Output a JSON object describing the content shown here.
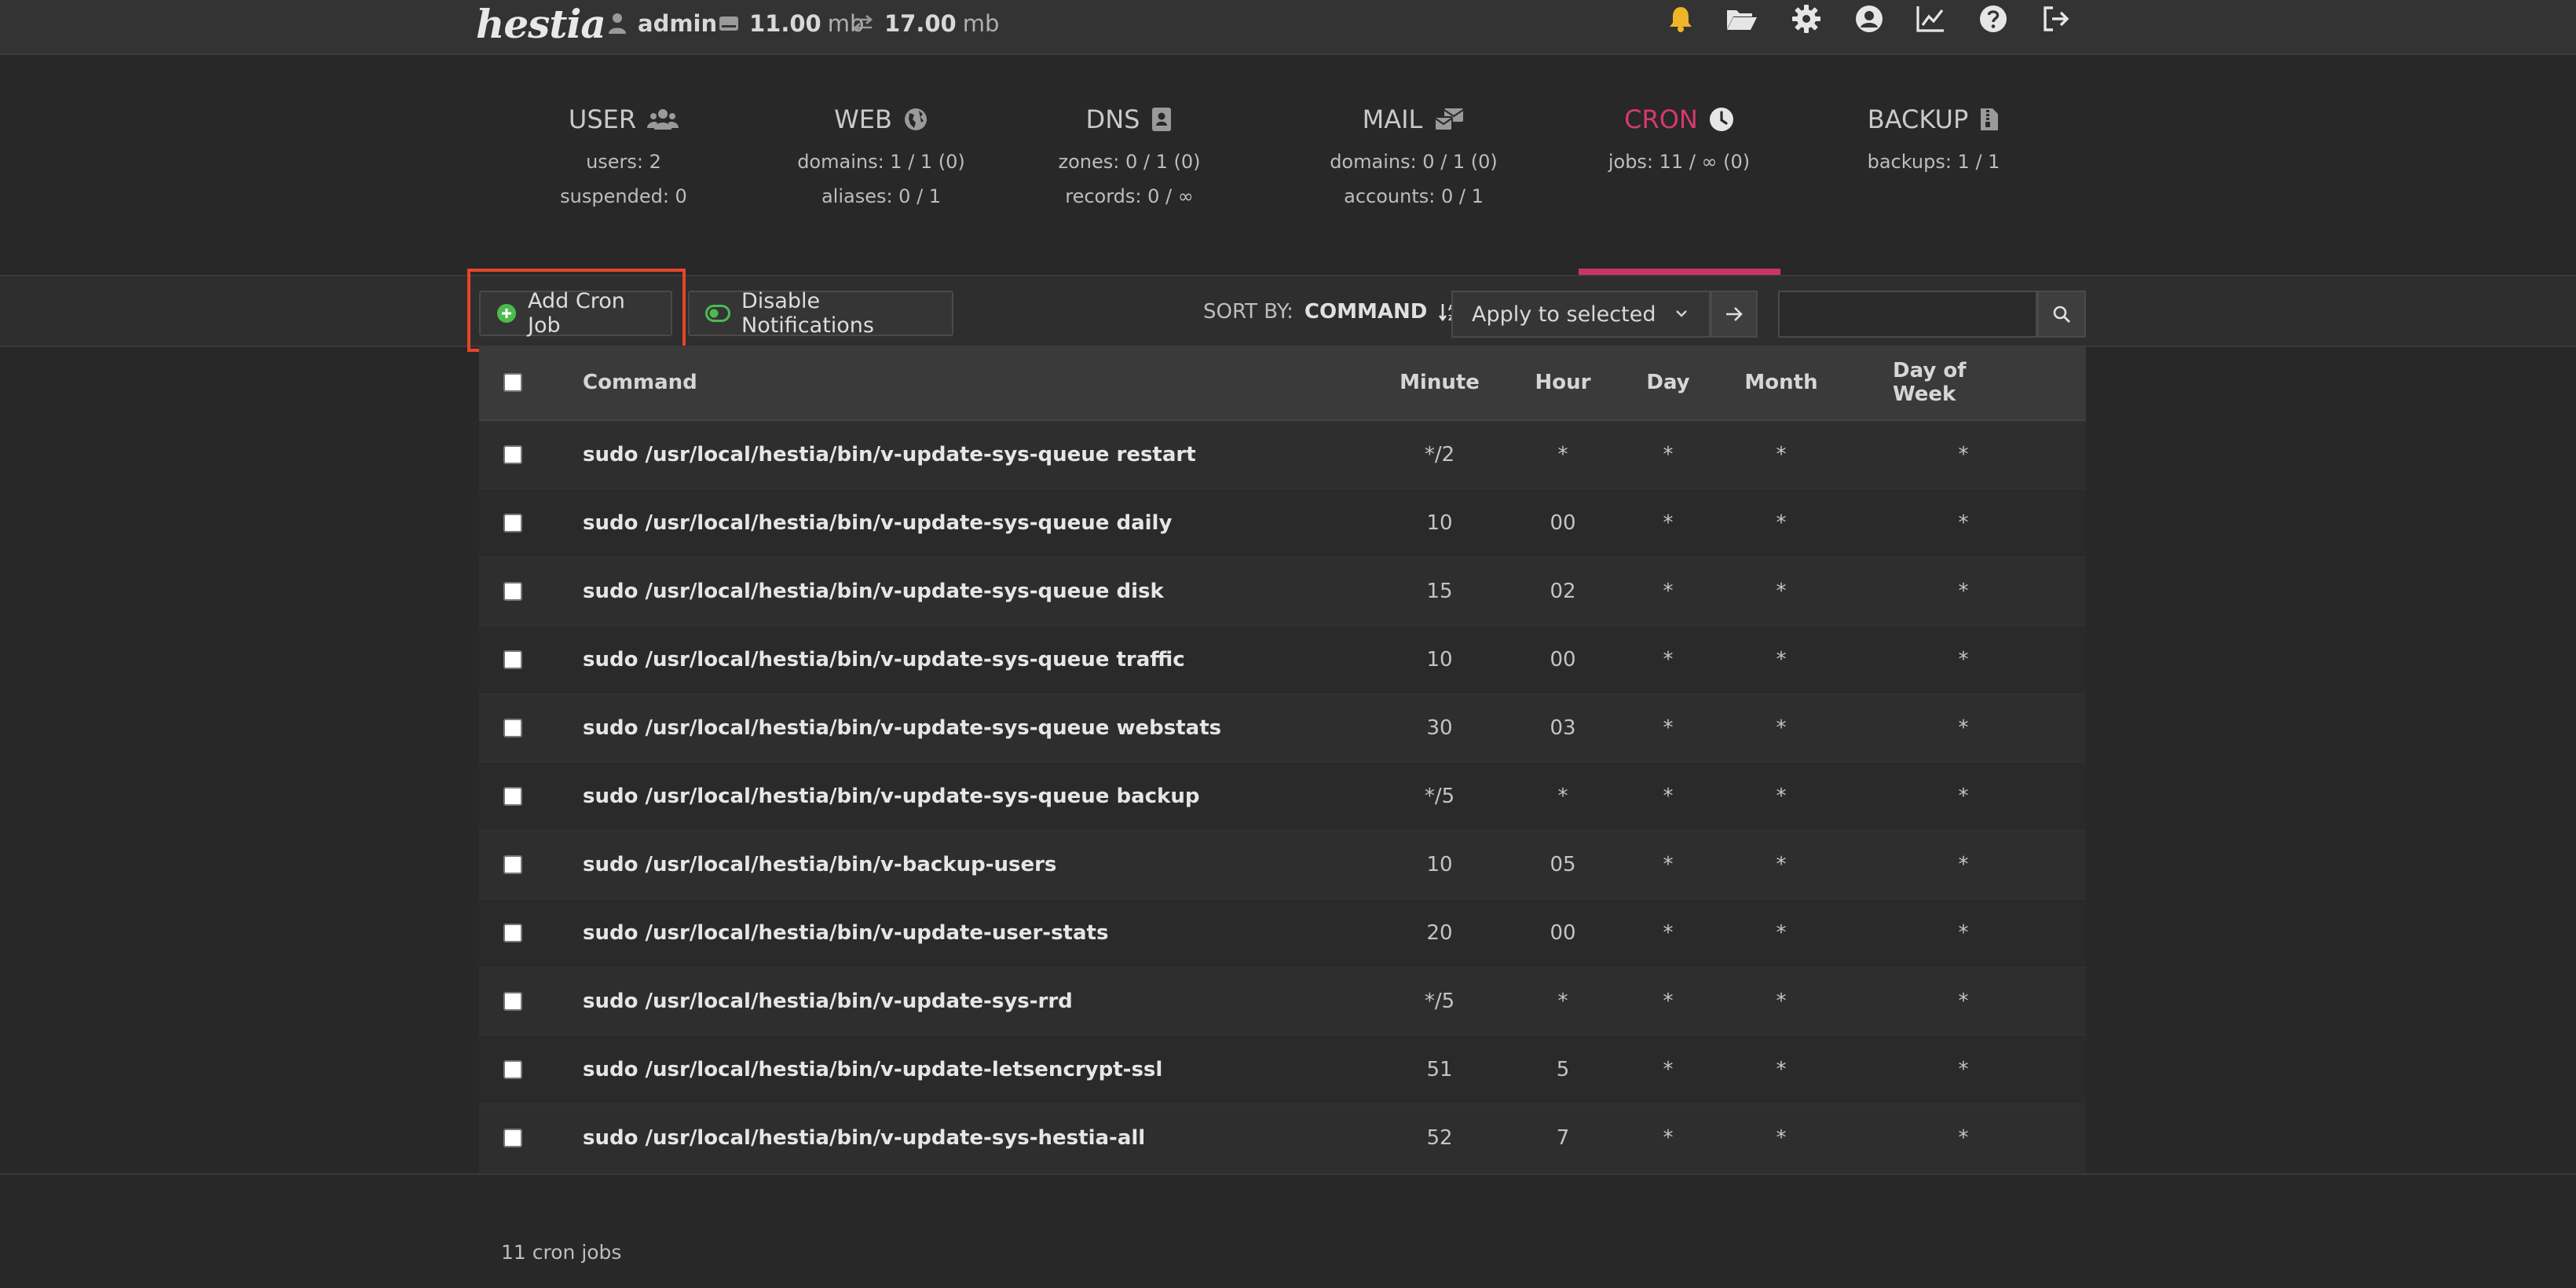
{
  "topbar": {
    "logo": "hestia",
    "user": "admin",
    "disk": "11.00",
    "disk_unit": "mb",
    "bandwidth": "17.00",
    "bandwidth_unit": "mb",
    "icons": [
      "bell-icon",
      "folder-open-icon",
      "gear-icon",
      "user-circle-icon",
      "chart-line-icon",
      "help-icon",
      "logout-icon"
    ],
    "bell_color": "#f0b429"
  },
  "stats": {
    "user": {
      "title": "USER",
      "line1": "users: 2",
      "line2": "suspended: 0"
    },
    "web": {
      "title": "WEB",
      "line1": "domains: 1 / 1 (0)",
      "line2": "aliases: 0 / 1"
    },
    "dns": {
      "title": "DNS",
      "line1": "zones: 0 / 1 (0)",
      "line2": "records: 0 / ∞"
    },
    "mail": {
      "title": "MAIL",
      "line1": "domains: 0 / 1 (0)",
      "line2": "accounts: 0 / 1"
    },
    "cron": {
      "title": "CRON",
      "line1": "jobs: 11 / ∞ (0)"
    },
    "backup": {
      "title": "BACKUP",
      "line1": "backups: 1 / 1"
    },
    "active_color": "#d6396f"
  },
  "toolbar": {
    "add_label": "Add Cron Job",
    "notify_label": "Disable Notifications",
    "sort_label": "SORT BY:",
    "sort_value": "COMMAND",
    "bulk_select_value": "Apply to selected",
    "search_placeholder": ""
  },
  "table": {
    "headers": {
      "command": "Command",
      "minute": "Minute",
      "hour": "Hour",
      "day": "Day",
      "month": "Month",
      "dow": "Day of Week"
    },
    "rows": [
      {
        "command": "sudo /usr/local/hestia/bin/v-update-sys-queue restart",
        "minute": "*/2",
        "hour": "*",
        "day": "*",
        "month": "*",
        "dow": "*"
      },
      {
        "command": "sudo /usr/local/hestia/bin/v-update-sys-queue daily",
        "minute": "10",
        "hour": "00",
        "day": "*",
        "month": "*",
        "dow": "*"
      },
      {
        "command": "sudo /usr/local/hestia/bin/v-update-sys-queue disk",
        "minute": "15",
        "hour": "02",
        "day": "*",
        "month": "*",
        "dow": "*"
      },
      {
        "command": "sudo /usr/local/hestia/bin/v-update-sys-queue traffic",
        "minute": "10",
        "hour": "00",
        "day": "*",
        "month": "*",
        "dow": "*"
      },
      {
        "command": "sudo /usr/local/hestia/bin/v-update-sys-queue webstats",
        "minute": "30",
        "hour": "03",
        "day": "*",
        "month": "*",
        "dow": "*"
      },
      {
        "command": "sudo /usr/local/hestia/bin/v-update-sys-queue backup",
        "minute": "*/5",
        "hour": "*",
        "day": "*",
        "month": "*",
        "dow": "*"
      },
      {
        "command": "sudo /usr/local/hestia/bin/v-backup-users",
        "minute": "10",
        "hour": "05",
        "day": "*",
        "month": "*",
        "dow": "*"
      },
      {
        "command": "sudo /usr/local/hestia/bin/v-update-user-stats",
        "minute": "20",
        "hour": "00",
        "day": "*",
        "month": "*",
        "dow": "*"
      },
      {
        "command": "sudo /usr/local/hestia/bin/v-update-sys-rrd",
        "minute": "*/5",
        "hour": "*",
        "day": "*",
        "month": "*",
        "dow": "*"
      },
      {
        "command": "sudo /usr/local/hestia/bin/v-update-letsencrypt-ssl",
        "minute": "51",
        "hour": "5",
        "day": "*",
        "month": "*",
        "dow": "*"
      },
      {
        "command": "sudo /usr/local/hestia/bin/v-update-sys-hestia-all",
        "minute": "52",
        "hour": "7",
        "day": "*",
        "month": "*",
        "dow": "*"
      }
    ]
  },
  "footer": {
    "count": "11 cron jobs"
  }
}
